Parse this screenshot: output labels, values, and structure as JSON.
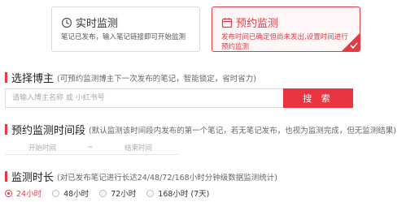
{
  "mode_cards": [
    {
      "title": "实时监测",
      "description": "笔记已发布，输入笔记链接即可开始监测",
      "icon": "clock-icon",
      "selected": false
    },
    {
      "title": "预约监测",
      "description": "发布时间已确定但尚未发出,设置时间进行预约监测",
      "icon": "calendar-icon",
      "selected": true
    }
  ],
  "blogger_section": {
    "title": "选择博主",
    "hint": "(可预约监测博主下一次发布的笔记，智能锁定，省时省力)",
    "search_placeholder": "请输入博主名称 或 小红书号",
    "search_button": "搜 索"
  },
  "time_section": {
    "title": "预约监测时间段",
    "hint": "(默认监测该时间段内发布的第一个笔记，若无笔记发布，也视为监测完成，但无监测结果)",
    "start_placeholder": "开始时间",
    "separator": "~",
    "end_placeholder": "结束时间"
  },
  "duration_section": {
    "title": "监测时长",
    "hint": "(对已发布笔记进行长达24/48/72/168小时分钟级数据监测统计)",
    "options": [
      {
        "label": "24小时",
        "checked": true
      },
      {
        "label": "48小时",
        "checked": false
      },
      {
        "label": "72小时",
        "checked": false
      },
      {
        "label": "168小时 (7天)",
        "checked": false
      }
    ]
  },
  "colors": {
    "accent": "#e23a46",
    "border": "#dcdcdc"
  }
}
